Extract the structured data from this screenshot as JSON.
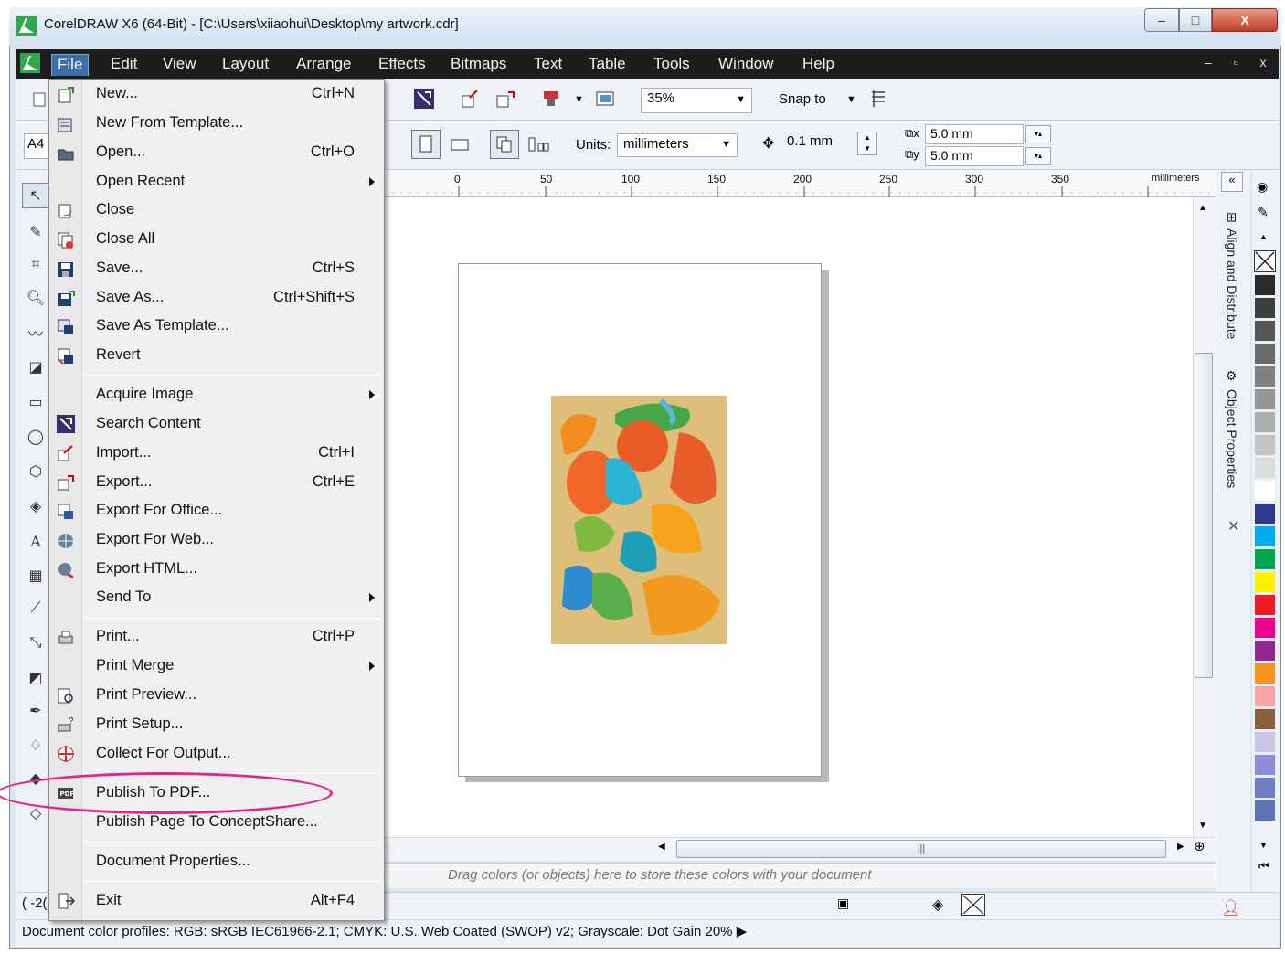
{
  "window": {
    "title": "CorelDRAW X6 (64-Bit) - [C:\\Users\\xiiaohui\\Desktop\\my artwork.cdr]",
    "controls": {
      "minimize": "–",
      "maximize": "□",
      "close": "X"
    }
  },
  "menubar": {
    "items": [
      {
        "label": "File"
      },
      {
        "label": "Edit"
      },
      {
        "label": "View"
      },
      {
        "label": "Layout"
      },
      {
        "label": "Arrange"
      },
      {
        "label": "Effects"
      },
      {
        "label": "Bitmaps"
      },
      {
        "label": "Text"
      },
      {
        "label": "Table"
      },
      {
        "label": "Tools"
      },
      {
        "label": "Window"
      },
      {
        "label": "Help"
      }
    ],
    "mdi_controls": "– ▫ x"
  },
  "toolbar1": {
    "zoom_value": "35%",
    "snap_to_label": "Snap to"
  },
  "toolbar2": {
    "page_size": "A4",
    "units_label": "Units:",
    "units_value": "millimeters",
    "nudge_value": "0.1 mm",
    "dup_x": "5.0 mm",
    "dup_y": "5.0 mm"
  },
  "ruler": {
    "ticks": [
      "0",
      "50",
      "100",
      "150",
      "200",
      "250",
      "300",
      "350"
    ],
    "unit_label": "millimeters"
  },
  "canvas": {
    "palette_hint": "Drag colors (or objects) here to store these colors with your document"
  },
  "docker": {
    "tabs": [
      "Align and Distribute",
      "Object Properties"
    ]
  },
  "palette": {
    "colors": [
      "#2b2b2b",
      "#3e3e3e",
      "#555555",
      "#6b6b6b",
      "#808080",
      "#969696",
      "#adadad",
      "#c4c4c4",
      "#dcdcdc",
      "#ffffff",
      "#2b3990",
      "#00aeef",
      "#00a651",
      "#fff200",
      "#ed1c24",
      "#ec008c",
      "#92278f",
      "#f7941d",
      "#f9a3a5",
      "#8b5e3c",
      "#c9c5e6",
      "#8e8cd8",
      "#6d7fc6",
      "#5b74b8"
    ]
  },
  "statusbar": {
    "coords": "( -2(",
    "color_profiles": "Document color profiles: RGB: sRGB IEC61966-2.1; CMYK: U.S. Web Coated (SWOP) v2; Grayscale: Dot Gain 20%"
  },
  "file_menu": {
    "items": [
      {
        "label": "New...",
        "shortcut": "Ctrl+N"
      },
      {
        "label": "New From Template...",
        "shortcut": ""
      },
      {
        "label": "Open...",
        "shortcut": "Ctrl+O"
      },
      {
        "label": "Open Recent",
        "shortcut": ""
      },
      {
        "label": "Close",
        "shortcut": ""
      },
      {
        "label": "Close All",
        "shortcut": ""
      },
      {
        "label": "Save...",
        "shortcut": "Ctrl+S"
      },
      {
        "label": "Save As...",
        "shortcut": "Ctrl+Shift+S"
      },
      {
        "label": "Save As Template...",
        "shortcut": ""
      },
      {
        "label": "Revert",
        "shortcut": ""
      },
      {
        "label": "Acquire Image",
        "shortcut": ""
      },
      {
        "label": "Search Content",
        "shortcut": ""
      },
      {
        "label": "Import...",
        "shortcut": "Ctrl+I"
      },
      {
        "label": "Export...",
        "shortcut": "Ctrl+E"
      },
      {
        "label": "Export For Office...",
        "shortcut": ""
      },
      {
        "label": "Export For Web...",
        "shortcut": ""
      },
      {
        "label": "Export HTML...",
        "shortcut": ""
      },
      {
        "label": "Send To",
        "shortcut": ""
      },
      {
        "label": "Print...",
        "shortcut": "Ctrl+P"
      },
      {
        "label": "Print Merge",
        "shortcut": ""
      },
      {
        "label": "Print Preview...",
        "shortcut": ""
      },
      {
        "label": "Print Setup...",
        "shortcut": ""
      },
      {
        "label": "Collect For Output...",
        "shortcut": ""
      },
      {
        "label": "Publish To PDF...",
        "shortcut": ""
      },
      {
        "label": "Publish Page To ConceptShare...",
        "shortcut": ""
      },
      {
        "label": "Document Properties...",
        "shortcut": ""
      },
      {
        "label": "Exit",
        "shortcut": "Alt+F4"
      }
    ]
  },
  "annotation": {
    "highlight_color": "#e0288c"
  }
}
